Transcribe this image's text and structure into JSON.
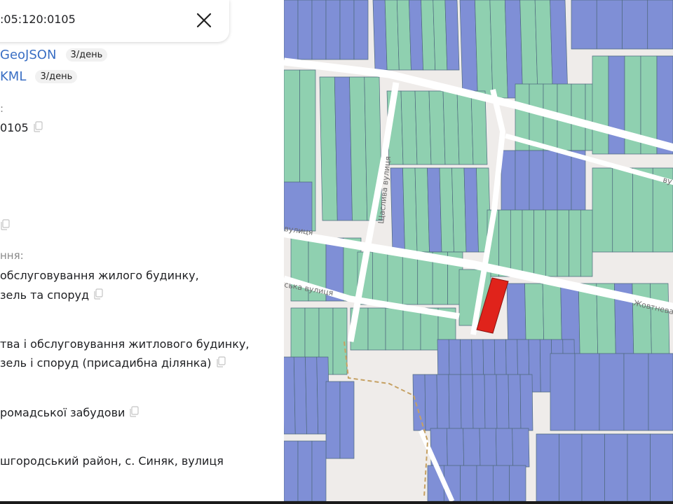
{
  "search": {
    "value": ":05:120:0105"
  },
  "downloads": [
    {
      "label": "GeoJSON",
      "quota": "3/день"
    },
    {
      "label": "KML",
      "quota": "3/день"
    }
  ],
  "fields": {
    "number_label": ":",
    "number_value": "0105",
    "purpose_label": "ння:",
    "purpose_line1": "обслуговування жилого будинку,",
    "purpose_line2": "зель та споруд",
    "purpose2_line1": "тва і обслуговування житлового будинку,",
    "purpose2_line2": "зель і споруд (присадибна ділянка)",
    "category_value": "ромадської забудови",
    "address_value": "шгородський район, с. Синяк, вулиця"
  },
  "map": {
    "streets": [
      "Щаслива вулиця",
      "Жовтнева",
      "вулиця",
      "ська вулиця",
      "ву"
    ],
    "colors": {
      "background": "#efecea",
      "road": "#ffffff",
      "parcel_green": "#8fd0b0",
      "parcel_blue": "#7f8fd6",
      "parcel_border": "#4f6a7e",
      "selected": "#e0231b",
      "boundary": "#c6a163"
    }
  }
}
